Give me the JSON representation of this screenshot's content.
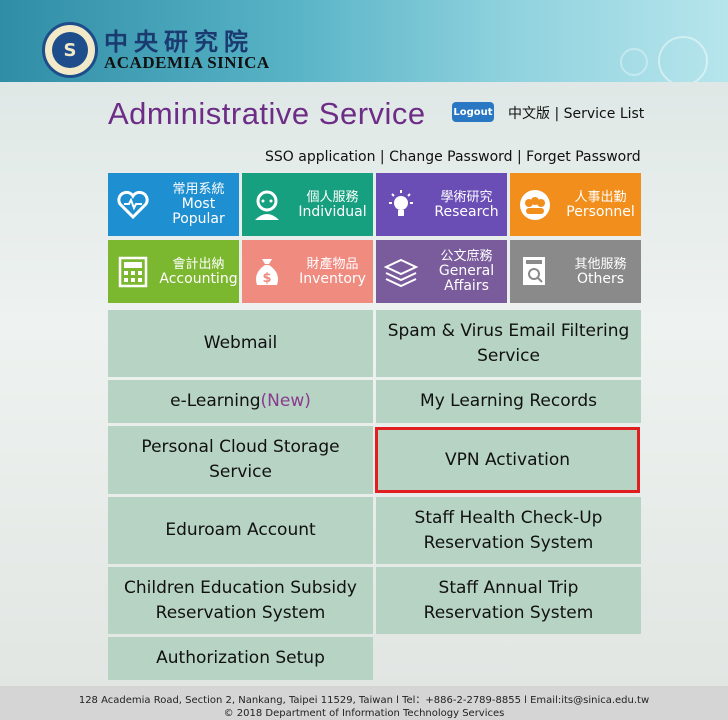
{
  "header": {
    "org_cn": "中央研究院",
    "org_en": "ACADEMIA SINICA",
    "seal_letter": "S"
  },
  "page_title": "Administrative Service",
  "logout_label": "Logout",
  "lang_link": "中文版",
  "service_list_link": "Service List",
  "sso_links": {
    "sso": "SSO application",
    "change": "Change Password",
    "forget": "Forget Password"
  },
  "tiles": [
    {
      "cn": "常用系統",
      "en": "Most Popular",
      "color": "#1e8fd0",
      "icon": "heart-icon"
    },
    {
      "cn": "個人服務",
      "en": "Individual",
      "color": "#17a07f",
      "icon": "person-icon"
    },
    {
      "cn": "學術研究",
      "en": "Research",
      "color": "#6a4db5",
      "icon": "lightbulb-icon"
    },
    {
      "cn": "人事出勤",
      "en": "Personnel",
      "color": "#f28e1c",
      "icon": "people-icon"
    },
    {
      "cn": "會計出納",
      "en": "Accounting",
      "color": "#7cb82f",
      "icon": "calculator-icon"
    },
    {
      "cn": "財產物品",
      "en": "Inventory",
      "color": "#f08b80",
      "icon": "moneybag-icon"
    },
    {
      "cn": "公文庶務",
      "en": "General Affairs",
      "color": "#7a5b9c",
      "icon": "layers-icon"
    },
    {
      "cn": "其他服務",
      "en": "Others",
      "color": "#8a8a8a",
      "icon": "document-search-icon"
    }
  ],
  "services": {
    "webmail": "Webmail",
    "spam": "Spam & Virus Email Filtering Service",
    "elearning": "e-Learning",
    "elearning_new": "(New)",
    "learning_records": "My Learning Records",
    "cloud": "Personal Cloud Storage Service",
    "vpn": "VPN Activation",
    "eduroam": "Eduroam Account",
    "health": "Staff Health Check-Up Reservation System",
    "children": "Children Education Subsidy Reservation System",
    "trip": "Staff Annual Trip Reservation System",
    "auth": "Authorization Setup"
  },
  "footer": {
    "line1": "128 Academia Road, Section 2, Nankang, Taipei 11529, Taiwan  l  Tel：+886-2-2789-8855   l  Email:its@sinica.edu.tw",
    "line2": "© 2018 Department of Information Technology Services"
  }
}
